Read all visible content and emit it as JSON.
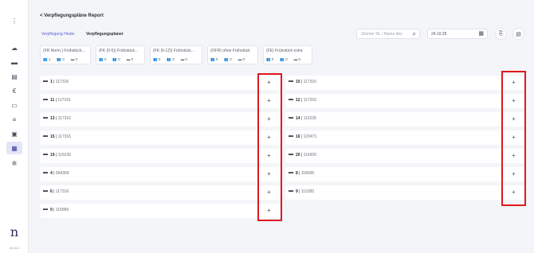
{
  "sidebar": {
    "icons": [
      {
        "name": "menu-dots-icon",
        "glyph": "⋮"
      },
      {
        "name": "cloud-icon",
        "glyph": "☁"
      },
      {
        "name": "bed-icon",
        "glyph": "▬"
      },
      {
        "name": "document-icon",
        "glyph": "▤"
      },
      {
        "name": "euro-icon",
        "glyph": "€"
      },
      {
        "name": "chat-icon",
        "glyph": "▭"
      },
      {
        "name": "list-icon",
        "glyph": "≡"
      },
      {
        "name": "contact-icon",
        "glyph": "▣"
      },
      {
        "name": "chart-icon",
        "glyph": "▦"
      },
      {
        "name": "gear-icon",
        "glyph": "✲"
      }
    ],
    "logo": "n",
    "version": "v11.6.2"
  },
  "header": {
    "title": "< Verpflegungspläne Report",
    "tabs": [
      {
        "label": "Verpflegung Heute",
        "active": true
      },
      {
        "label": "Verpflegungsplaner",
        "active": false
      }
    ]
  },
  "search": {
    "placeholder": "Zimmer Nr. / Name des"
  },
  "date": {
    "value": "24.10.25"
  },
  "colors": {
    "accent": "#5a5fd0",
    "highlight": "#e0181e"
  },
  "summary_cards": [
    {
      "title": "(FR Norm.) Frühstück...",
      "stats": [
        "👥 1",
        "👥 0",
        "▬ 0"
      ]
    },
    {
      "title": "(FK (0-5)) Frühstück...",
      "stats": [
        "👥 0",
        "👥 0",
        "▬ 0"
      ]
    },
    {
      "title": "(FK (6-12)) Frühstück...",
      "stats": [
        "👥 0",
        "👥 0",
        "▬ 0"
      ]
    },
    {
      "title": "(OFR) ohne Frühstück",
      "stats": [
        "👥 0",
        "👥 0",
        "▬ 0"
      ]
    },
    {
      "title": "(FE) Frühstück extra",
      "stats": [
        "👥 0",
        "👥 0",
        "▬ 0"
      ]
    }
  ],
  "rooms_left": [
    {
      "num": "1",
      "code": "117316"
    },
    {
      "num": "11",
      "code": "117316"
    },
    {
      "num": "13",
      "code": "117316"
    },
    {
      "num": "15",
      "code": "117316"
    },
    {
      "num": "19",
      "code": "116235"
    },
    {
      "num": "4",
      "code": "994309"
    },
    {
      "num": "6",
      "code": "117316"
    },
    {
      "num": "9",
      "code": "115889"
    }
  ],
  "rooms_right": [
    {
      "num": "10",
      "code": "117316"
    },
    {
      "num": "12",
      "code": "117316"
    },
    {
      "num": "14",
      "code": "116235"
    },
    {
      "num": "16",
      "code": "120471"
    },
    {
      "num": "20",
      "code": "114309"
    },
    {
      "num": "8",
      "code": "118595"
    },
    {
      "num": "9",
      "code": "110382"
    }
  ],
  "add_label": "+"
}
